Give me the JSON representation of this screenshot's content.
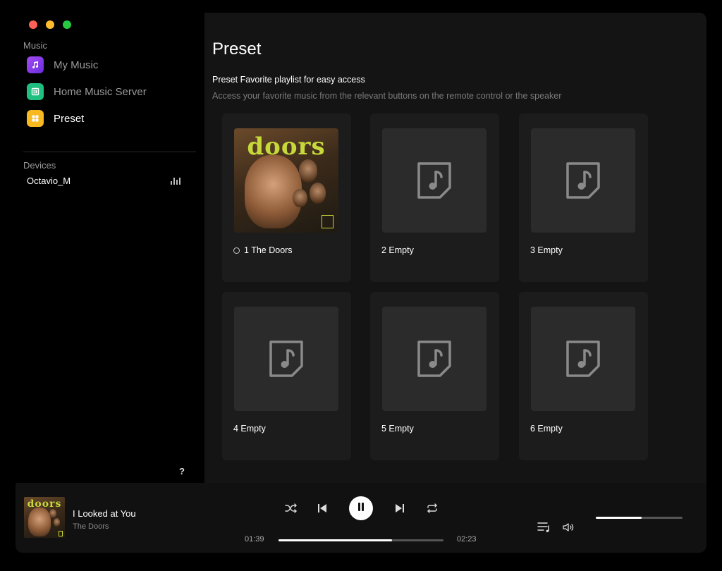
{
  "sidebar": {
    "music_label": "Music",
    "items": [
      {
        "label": "My Music",
        "icon": "music-note-icon",
        "active": false
      },
      {
        "label": "Home Music Server",
        "icon": "server-icon",
        "active": false
      },
      {
        "label": "Preset",
        "icon": "preset-grid-icon",
        "active": true
      }
    ],
    "devices_label": "Devices",
    "device": {
      "name": "Octavio_M",
      "icon": "signal-bars-icon"
    },
    "help_label": "?"
  },
  "main": {
    "title": "Preset",
    "subtitle": "Preset Favorite playlist for easy access",
    "description": "Access your favorite music from the relevant buttons on the remote control or the speaker",
    "presets": [
      {
        "label": "1 The Doors",
        "art": "album",
        "loading": true
      },
      {
        "label": "2 Empty",
        "art": "empty"
      },
      {
        "label": "3 Empty",
        "art": "empty"
      },
      {
        "label": "4 Empty",
        "art": "empty"
      },
      {
        "label": "5 Empty",
        "art": "empty"
      },
      {
        "label": "6 Empty",
        "art": "empty"
      }
    ]
  },
  "album_logo": "doors",
  "player": {
    "title": "I Looked at You",
    "artist": "The Doors",
    "elapsed": "01:39",
    "duration": "02:23",
    "progress": 0.69,
    "volume": 0.53,
    "accent": "#ffffff"
  }
}
